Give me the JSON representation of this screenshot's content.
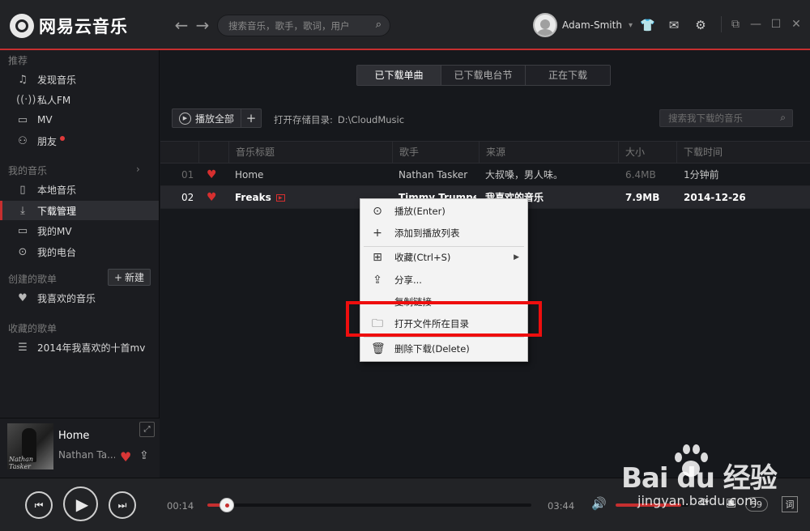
{
  "app": {
    "title": "网易云音乐",
    "search_placeholder": "搜索音乐，歌手，歌词，用户",
    "username": "Adam-Smith"
  },
  "sidebar": {
    "sections": {
      "recommend": "推荐",
      "my_music": "我的音乐",
      "created": "创建的歌单",
      "collected": "收藏的歌单"
    },
    "recommend_items": [
      {
        "label": "发现音乐",
        "icon": "music-note-icon"
      },
      {
        "label": "私人FM",
        "icon": "radio-icon"
      },
      {
        "label": "MV",
        "icon": "mv-icon"
      },
      {
        "label": "朋友",
        "icon": "friends-icon"
      }
    ],
    "my_music_items": [
      {
        "label": "本地音乐",
        "icon": "local-music-icon"
      },
      {
        "label": "下载管理",
        "icon": "download-icon",
        "active": true
      },
      {
        "label": "我的MV",
        "icon": "mv-icon"
      },
      {
        "label": "我的电台",
        "icon": "podcast-icon"
      }
    ],
    "new_playlist_label": "新建",
    "created_items": [
      {
        "label": "我喜欢的音乐",
        "icon": "heart-icon"
      }
    ],
    "collected_items": [
      {
        "label": "2014年我喜欢的十首mv",
        "icon": "playlist-icon"
      }
    ]
  },
  "now_playing": {
    "title": "Home",
    "artist": "Nathan Ta...",
    "cover_signature": "Nathan Tasker"
  },
  "main": {
    "tabs": [
      {
        "label": "已下载单曲",
        "active": true
      },
      {
        "label": "已下载电台节目",
        "active": false
      },
      {
        "label": "正在下载",
        "active": false
      }
    ],
    "play_all_label": "播放全部",
    "dir_label": "打开存储目录:",
    "dir_path": "D:\\CloudMusic",
    "local_search_placeholder": "搜索我下载的音乐",
    "columns": [
      "音乐标题",
      "歌手",
      "来源",
      "大小",
      "下载时间"
    ],
    "rows": [
      {
        "num": "01",
        "title": "Home",
        "artist": "Nathan Tasker",
        "source": "大叔嗓，男人味。",
        "size": "6.4MB",
        "time": "1分钟前",
        "mv": false
      },
      {
        "num": "02",
        "title": "Freaks",
        "artist": "Timmy Trumpet",
        "source": "我喜欢的音乐",
        "size": "7.9MB",
        "time": "2014-12-26",
        "mv": true
      }
    ]
  },
  "context_menu": {
    "items": [
      {
        "label": "播放(Enter)",
        "icon": "play-circle-icon"
      },
      {
        "label": "添加到播放列表",
        "icon": "plus-icon"
      },
      {
        "label": "收藏(Ctrl+S)",
        "icon": "collect-icon"
      },
      {
        "label": "分享...",
        "icon": "share-icon"
      },
      {
        "label": "复制链接",
        "icon": ""
      },
      {
        "label": "打开文件所在目录",
        "icon": "folder-open-icon"
      },
      {
        "label": "删除下载(Delete)",
        "icon": "trash-icon"
      }
    ]
  },
  "player": {
    "current_time": "00:14",
    "total_time": "03:44",
    "progress": 0.06,
    "volume": 0.9,
    "playlist_count": "59",
    "lyric_label": "词"
  },
  "watermark": {
    "brand": "Bai du 经验",
    "url": "jingyan.baidu.com"
  },
  "colors": {
    "accent": "#c62f2f",
    "highlight_box": "#ee0e0e"
  }
}
